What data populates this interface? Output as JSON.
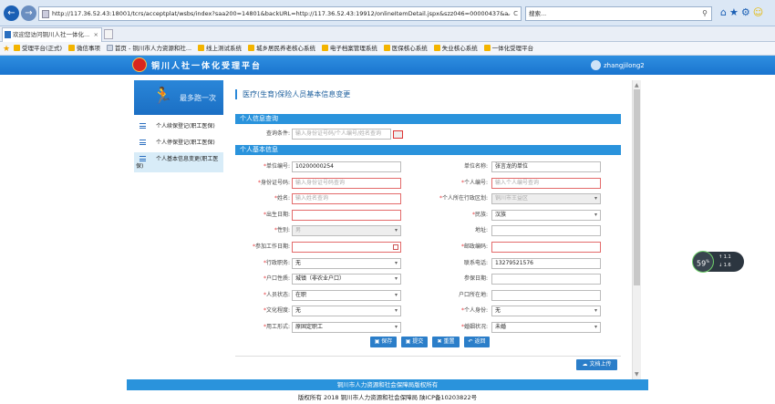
{
  "browser": {
    "url": "http://117.36.52.43:18001/tcrs/acceptplat/wsbs/index?saa200=14801&backURL=http://117.36.52.43:19912/onlineItemDetail.jspx&szz046=00000437&a",
    "search_placeholder": "搜索...",
    "tab_title": "欢迎您访问铜川人社一体化...",
    "favorites": [
      "受理平台(正式)",
      "微信事项",
      "首页 - 铜川市人力资源和社...",
      "线上测试系统",
      "城乡居民养老核心系统",
      "电子档案管理系统",
      "医保核心系统",
      "失业核心系统",
      "一体化受理平台"
    ]
  },
  "header": {
    "title": "铜川人社一体化受理平台",
    "username": "zhangjilong2"
  },
  "sidebar": {
    "banner": "最多跑一次",
    "items": [
      {
        "label": "个人续保登记(职工医保)"
      },
      {
        "label": "个人停保登记(职工医保)"
      },
      {
        "label": "个人基本信息变更(职工医保)"
      }
    ]
  },
  "form": {
    "page_title": "医疗(生育)保险人员基本信息变更",
    "section_query": "个人信息查询",
    "query_label": "查询条件:",
    "query_placeholder": "输入身份证号码/个人编号/姓名查询",
    "section_basic": "个人基本信息",
    "left": [
      {
        "label": "单位编号:",
        "required": true,
        "value": "10200000254"
      },
      {
        "label": "身份证号码:",
        "required": true,
        "placeholder": "输入身份证号码查询"
      },
      {
        "label": "姓名:",
        "required": true,
        "placeholder": "输入姓名查询"
      },
      {
        "label": "出生日期:",
        "required": true,
        "value": ""
      },
      {
        "label": "性别:",
        "required": true,
        "value": "男"
      },
      {
        "label": "参加工作日期:",
        "required": true,
        "value": ""
      },
      {
        "label": "行政职务:",
        "required": true,
        "value": "无"
      },
      {
        "label": "户口性质:",
        "required": true,
        "value": "城镇（非农业户口）"
      },
      {
        "label": "人员状态:",
        "required": true,
        "value": "在职"
      },
      {
        "label": "文化程度:",
        "required": true,
        "value": "无"
      },
      {
        "label": "用工形式:",
        "required": true,
        "value": "原固定职工"
      }
    ],
    "right": [
      {
        "label": "单位名称:",
        "required": false,
        "value": "张言龙的单位"
      },
      {
        "label": "个人编号:",
        "required": true,
        "placeholder": "输入个人编号查询"
      },
      {
        "label": "个人所在行政区划:",
        "required": true,
        "value": "铜川市王益区"
      },
      {
        "label": "民族:",
        "required": true,
        "value": "汉族"
      },
      {
        "label": "地址:",
        "required": false,
        "value": ""
      },
      {
        "label": "邮政编码:",
        "required": true,
        "value": ""
      },
      {
        "label": "联系电话:",
        "required": false,
        "value": "13279521576"
      },
      {
        "label": "参保日期:",
        "required": false,
        "value": ""
      },
      {
        "label": "户口所在地:",
        "required": false,
        "value": ""
      },
      {
        "label": "个人身份:",
        "required": true,
        "value": "无"
      },
      {
        "label": "婚姻状况:",
        "required": true,
        "value": "未婚"
      }
    ],
    "buttons": {
      "save": "保存",
      "submit": "提交",
      "reset": "重置",
      "back": "返回"
    },
    "upload": "文档上传"
  },
  "footer": {
    "line1": "铜川市人力资源和社会保障局版权所有",
    "line2": "版权所有 2018 铜川市人力资源和社会保障局 陕ICP备10203822号"
  },
  "speed_widget": {
    "percent": "59",
    "percent_unit": "%",
    "up": "1.1",
    "down": "1.6"
  }
}
